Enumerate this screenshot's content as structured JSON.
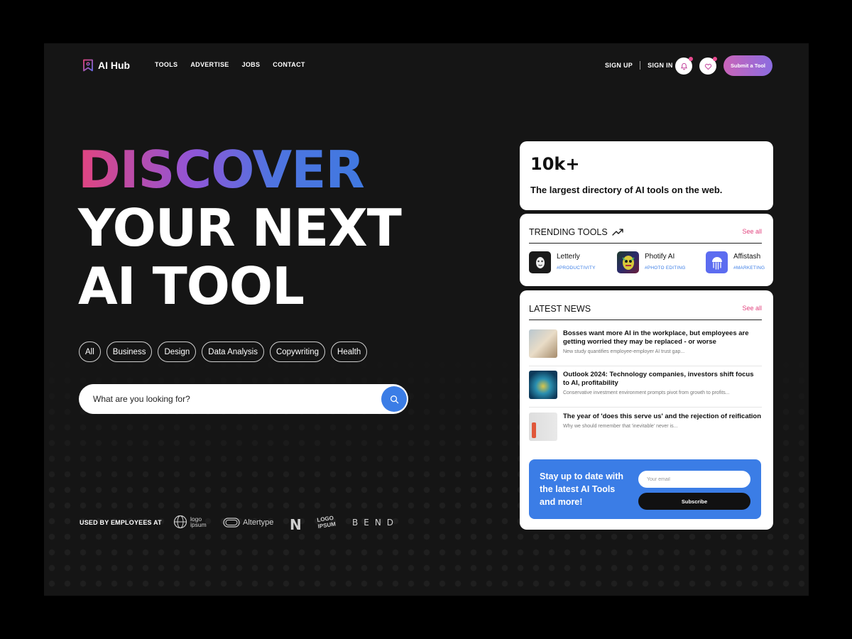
{
  "nav": {
    "logo_text": "AI Hub",
    "links": [
      "TOOLS",
      "ADVERTISE",
      "JOBS",
      "CONTACT"
    ],
    "sign_up": "SIGN UP",
    "sign_in": "SIGN IN",
    "submit_label": "Submit a Tool",
    "icons": [
      "bell-icon",
      "heart-icon"
    ]
  },
  "hero": {
    "line1": "DISCOVER",
    "line2": "YOUR NEXT",
    "line3": "AI TOOL"
  },
  "chips": [
    "All",
    "Business",
    "Design",
    "Data Analysis",
    "Copywriting",
    "Health"
  ],
  "search": {
    "placeholder": "What are you looking for?"
  },
  "used_by": {
    "label": "USED BY EMPLOYEES AT",
    "brands": [
      "logo ipsum",
      "Altertype",
      "N",
      "LOGO IPSUM",
      "BEND"
    ]
  },
  "stats": {
    "count": "10k+",
    "tagline": "The largest directory of AI tools on the web."
  },
  "trending": {
    "title": "TRENDING TOOLS",
    "see_all": "See all",
    "tools": [
      {
        "name": "Letterly",
        "tag": "#PRODUCTIVITY"
      },
      {
        "name": "Photify AI",
        "tag": "#PHOTO EDITING"
      },
      {
        "name": "Affistash",
        "tag": "#MARKETING"
      }
    ]
  },
  "news": {
    "title": "LATEST NEWS",
    "see_all": "See all",
    "items": [
      {
        "headline": "Bosses want more AI in the workplace, but employees are getting worried they may be replaced - or worse",
        "desc": "New study quantifies employee-employer AI trust gap..."
      },
      {
        "headline": "Outlook 2024: Technology companies, investors shift focus to AI, profitability",
        "desc": "Conservative investment environment prompts pivot from growth to profits..."
      },
      {
        "headline": "The year of 'does this serve us' and the rejection of reification",
        "desc": "Why we should remember that 'inevitable' never is..."
      }
    ]
  },
  "subscribe": {
    "title": "Stay up to date with the latest AI Tools and more!",
    "placeholder": "Your email",
    "button": "Subscribe"
  },
  "colors": {
    "accent_blue": "#3b7de6",
    "accent_pink": "#e2447f",
    "background": "#151515"
  }
}
